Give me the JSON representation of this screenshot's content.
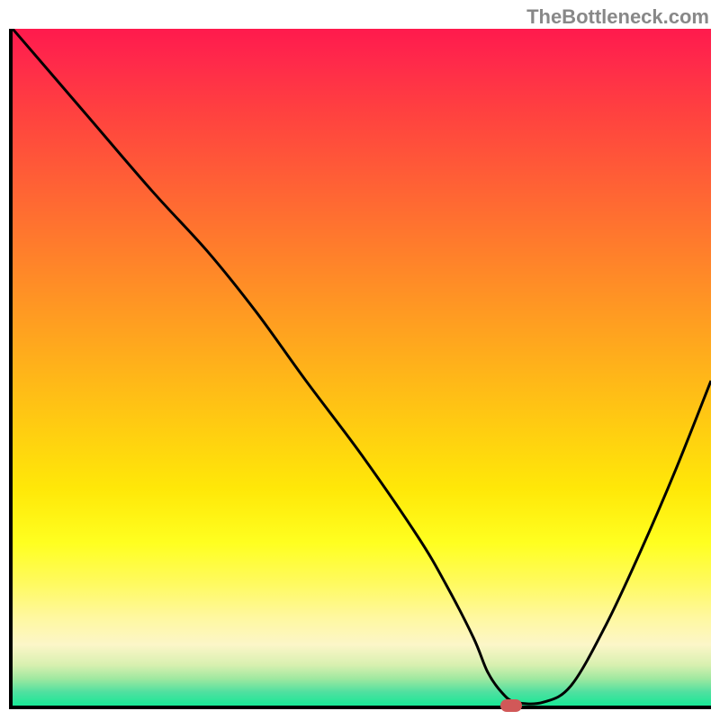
{
  "watermark": "TheBottleneck.com",
  "chart_data": {
    "type": "line",
    "title": "",
    "xlabel": "",
    "ylabel": "",
    "xlim": [
      0,
      100
    ],
    "ylim": [
      0,
      100
    ],
    "x": [
      0,
      10,
      20,
      28,
      35,
      42,
      50,
      58,
      62,
      66,
      68,
      70,
      72,
      76,
      80,
      85,
      90,
      95,
      100
    ],
    "y": [
      100,
      88,
      76,
      67,
      58,
      48,
      37,
      25,
      18,
      10,
      5,
      2,
      0.5,
      0.5,
      3,
      12,
      23,
      35,
      48
    ],
    "marker": {
      "x": 71,
      "y": 0.5
    },
    "annotations": []
  },
  "colors": {
    "axis": "#000000",
    "curve": "#000000",
    "marker": "#d15858",
    "watermark": "#888888"
  }
}
